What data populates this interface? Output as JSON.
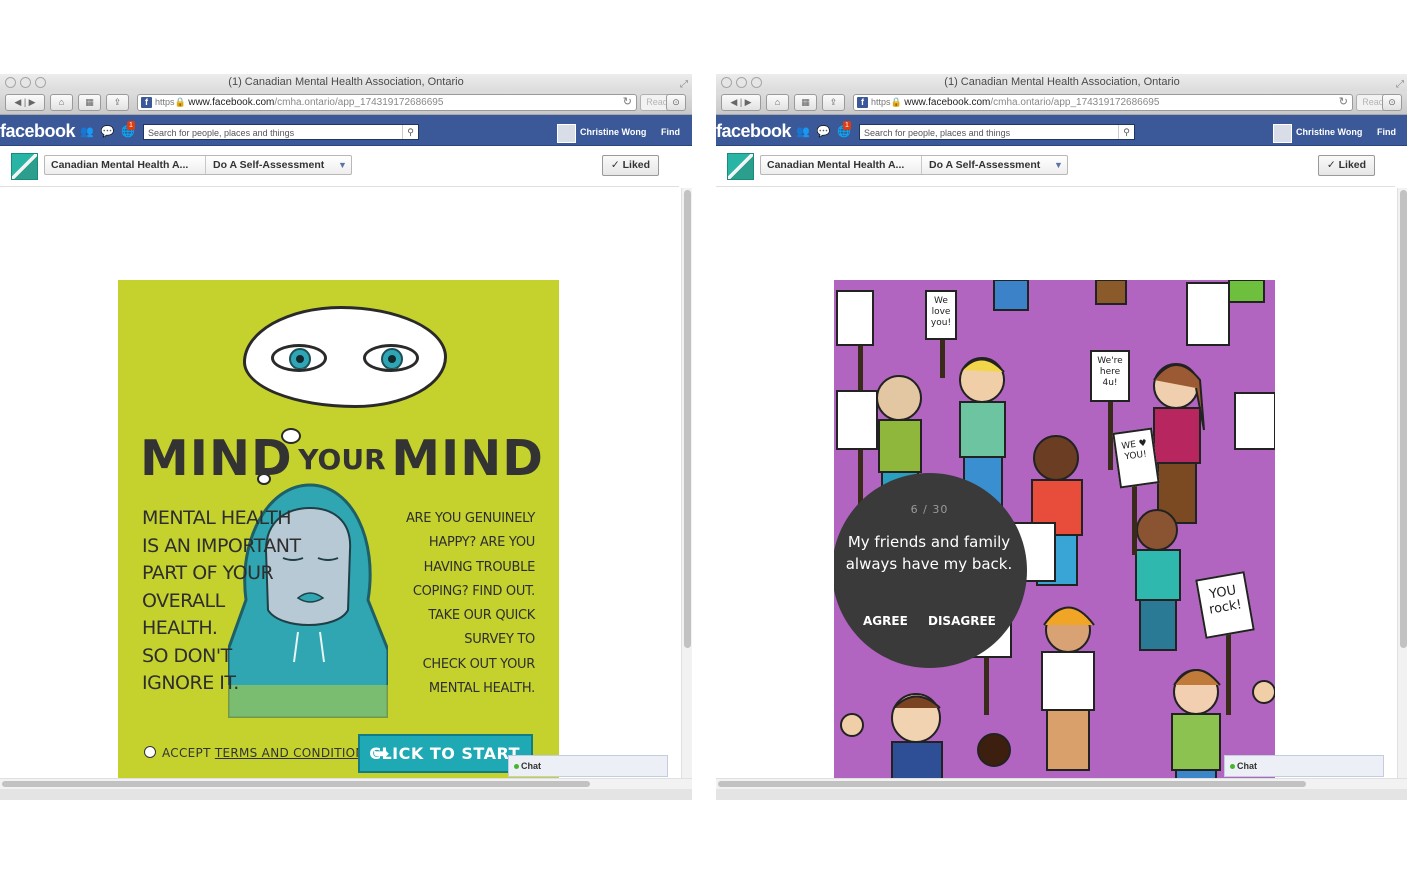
{
  "windows": [
    {
      "title": "(1) Canadian Mental Health Association, Ontario",
      "url": {
        "https": "https",
        "domain": "www.facebook.com",
        "path": "/cmha.ontario/app_174319172686695"
      },
      "reader": "Reader",
      "fb": {
        "logo": "facebook",
        "notifications": "1",
        "search_placeholder": "Search for people, places and things",
        "user": "Christine Wong",
        "find": "Find"
      },
      "page": {
        "name": "Canadian Mental Health A...",
        "subpage": "Do A Self-Assessment",
        "liked": "✓ Liked"
      },
      "chat": "Chat",
      "app": {
        "headline": {
          "word1": "MIND",
          "word2": "YOUR",
          "word3": "MIND"
        },
        "left_text": "MENTAL HEALTH\nIS AN IMPORTANT\nPART OF YOUR\nOVERALL\nHEALTH.\nSO DON'T\nIGNORE IT.",
        "right_text": "ARE YOU GENUINELY\nHAPPY? ARE YOU\nHAVING TROUBLE\nCOPING? FIND OUT.\nTAKE OUR QUICK\nSURVEY TO\nCHECK OUT YOUR\nMENTAL HEALTH.",
        "accept_label": "ACCEPT",
        "terms_link": "TERMS AND CONDITIONS",
        "start_button": "CLICK TO START"
      }
    },
    {
      "title": "(1) Canadian Mental Health Association, Ontario",
      "url": {
        "https": "https",
        "domain": "www.facebook.com",
        "path": "/cmha.ontario/app_174319172686695"
      },
      "reader": "Reader",
      "fb": {
        "logo": "facebook",
        "notifications": "1",
        "search_placeholder": "Search for people, places and things",
        "user": "Christine Wong",
        "find": "Find"
      },
      "page": {
        "name": "Canadian Mental Health A...",
        "subpage": "Do A Self-Assessment",
        "liked": "✓ Liked"
      },
      "chat": "Chat",
      "app": {
        "question_count": "6 / 30",
        "question": "My friends and family always have my back.",
        "agree": "AGREE",
        "disagree": "DISAGREE",
        "signs": [
          "We love you!",
          "We're here 4u!",
          "WE ♥ YOU!",
          "YOU rock!"
        ]
      }
    }
  ],
  "colors": {
    "facebook_blue": "#3b5998",
    "left_art_background": "#c5d22e",
    "start_button": "#1ea9b4",
    "right_art_background": "#b164c0",
    "question_circle": "#3a3a3a"
  }
}
